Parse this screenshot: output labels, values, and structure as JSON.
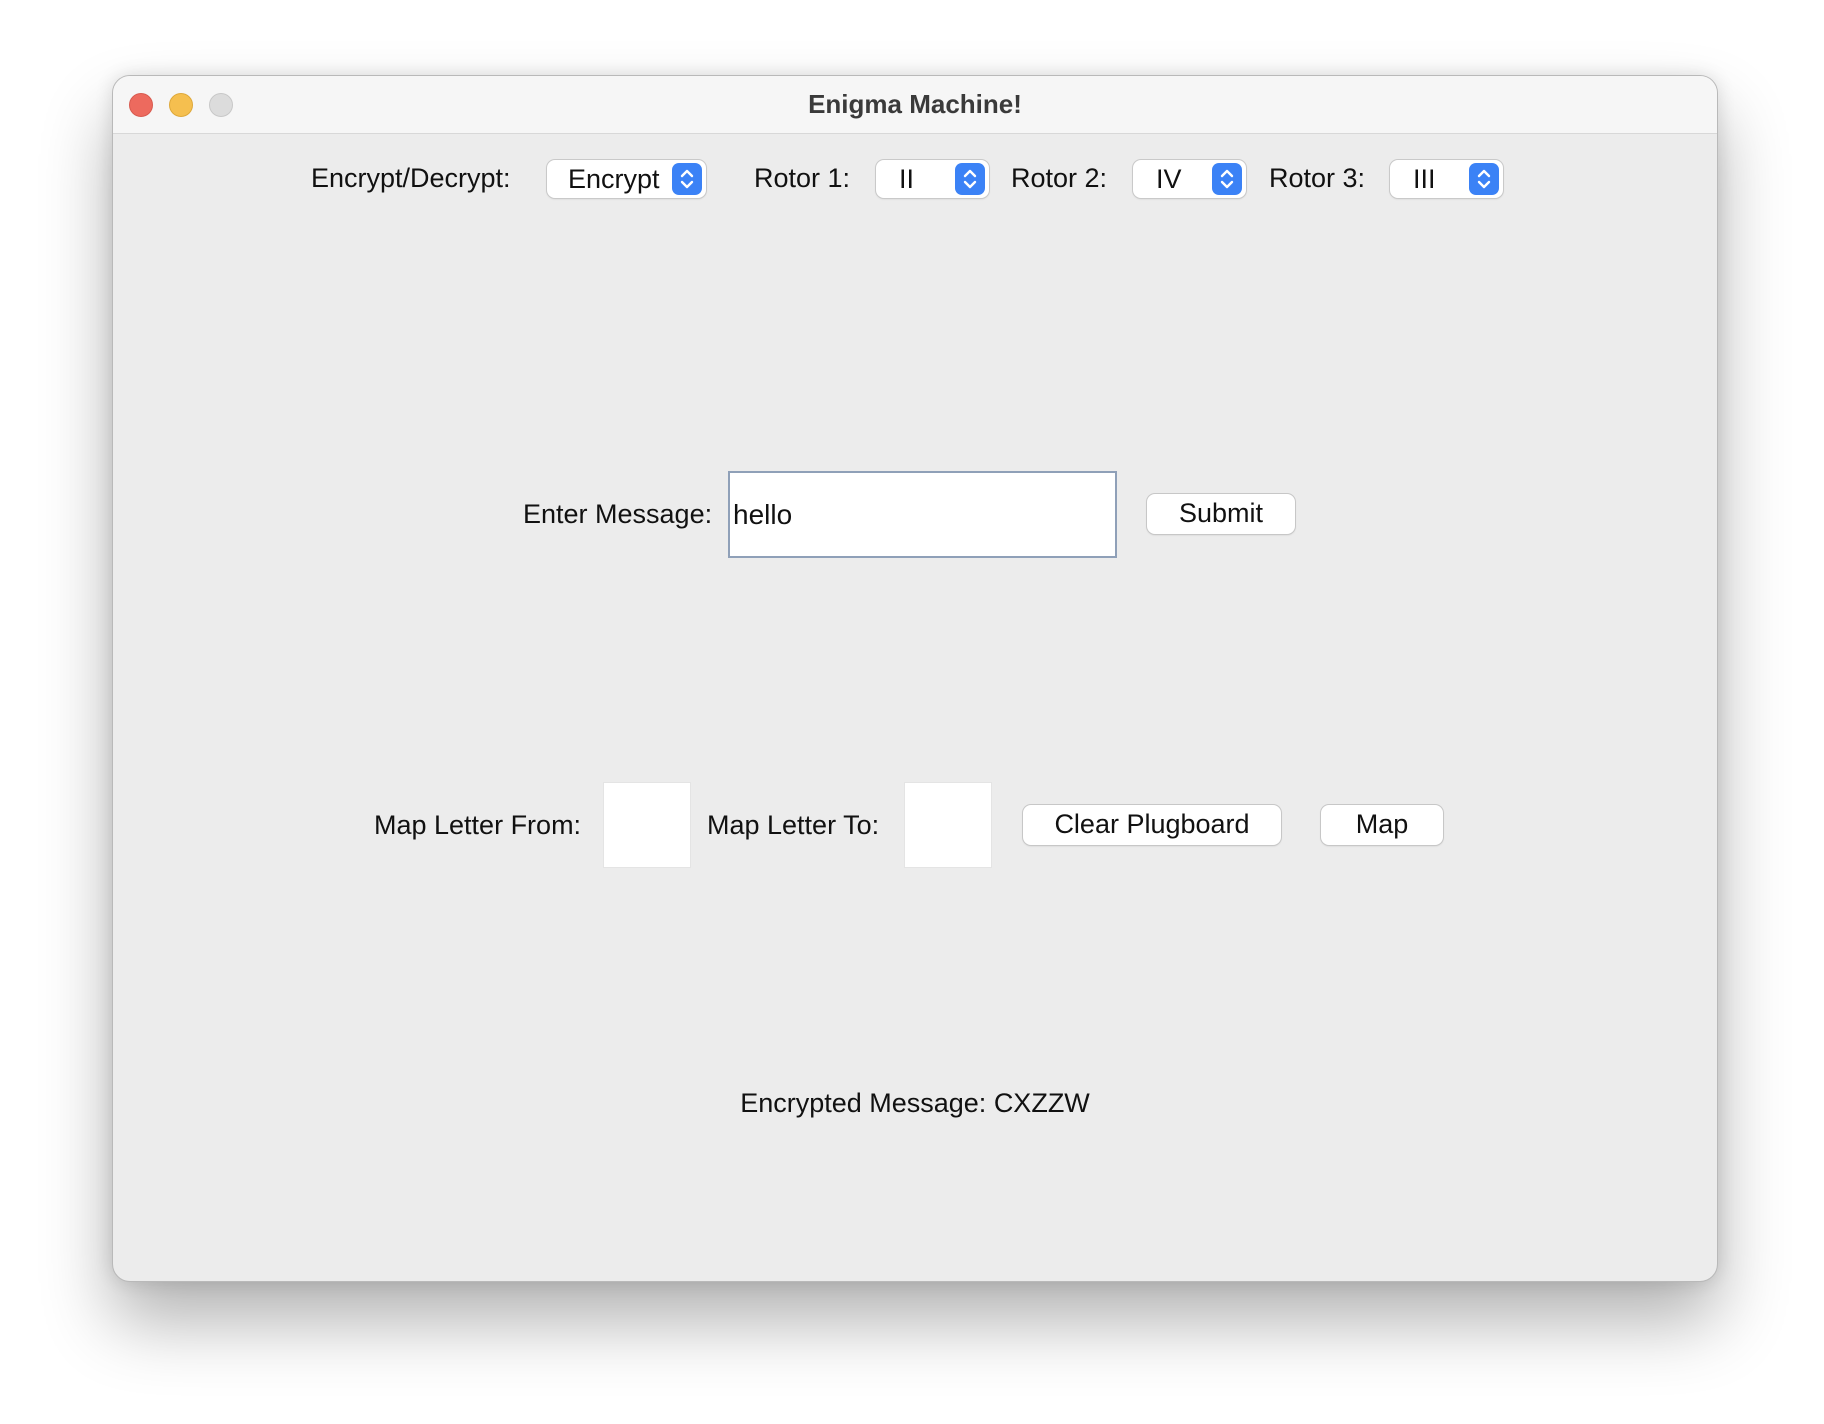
{
  "window": {
    "title": "Enigma Machine!"
  },
  "controls": {
    "mode_label": "Encrypt/Decrypt:",
    "mode_value": "Encrypt",
    "rotor1_label": "Rotor 1:",
    "rotor1_value": "II",
    "rotor2_label": "Rotor 2:",
    "rotor2_value": "IV",
    "rotor3_label": "Rotor 3:",
    "rotor3_value": "III"
  },
  "message": {
    "label": "Enter Message:",
    "value": "hello",
    "submit_label": "Submit"
  },
  "plugboard": {
    "from_label": "Map Letter From:",
    "from_value": "",
    "to_label": "Map Letter To:",
    "to_value": "",
    "clear_label": "Clear Plugboard",
    "map_label": "Map"
  },
  "result": {
    "text": "Encrypted Message: CXZZW"
  },
  "colors": {
    "accent": "#3b82f6",
    "close": "#ed6a5e",
    "minimize": "#f5bf4f",
    "zoom_inactive": "#dcdcdc"
  }
}
